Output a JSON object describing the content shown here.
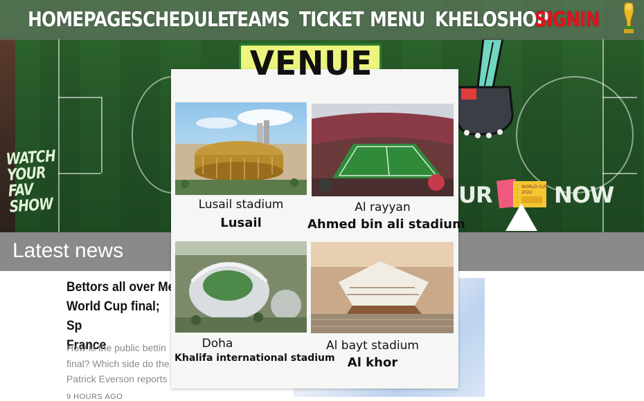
{
  "navbar": {
    "items": [
      {
        "label": "HOMEPAGE"
      },
      {
        "label": "SCHEDULE"
      },
      {
        "label": "TEAMS"
      },
      {
        "label": "TICKET"
      },
      {
        "label": "MENU"
      },
      {
        "label": "KHELOSHOP"
      },
      {
        "label": "SIGNIN"
      }
    ],
    "signin_color": "#e3131c",
    "trophy_icon": "world-cup-trophy-icon"
  },
  "hero": {
    "watch_promo": [
      "WATCH",
      "YOUR",
      "FAV",
      "SHOW"
    ],
    "ticket_promo_left": "UR",
    "ticket_promo_right": "NOW",
    "ticket_card_text": [
      "WORLD CUP",
      "2022"
    ]
  },
  "venue": {
    "title": "VENUE",
    "title_bg": "#eef57e",
    "cards": [
      {
        "top": "Lusail stadium",
        "bottom": "Lusail",
        "image": "lusail-stadium-image"
      },
      {
        "top": "Al rayyan",
        "bottom": "Ahmed bin ali stadium",
        "image": "ahmed-bin-ali-stadium-image"
      },
      {
        "top": "Doha",
        "bottom": "Khalifa international stadium",
        "image": "khalifa-international-stadium-image"
      },
      {
        "top": "Al bayt stadium",
        "bottom": "Al khor",
        "image": "al-bayt-stadium-image"
      }
    ]
  },
  "news": {
    "section_title": "Latest news",
    "headline": "Bettors all over Me World Cup final; Sp France",
    "headline_lines": [
      "Bettors all over Me",
      "World Cup final; Sp",
      "France"
    ],
    "body_lines": [
      "How is the public bettin",
      "final? Which side do the",
      "Patrick Everson reports"
    ],
    "time": "9 HOURS AGO"
  }
}
